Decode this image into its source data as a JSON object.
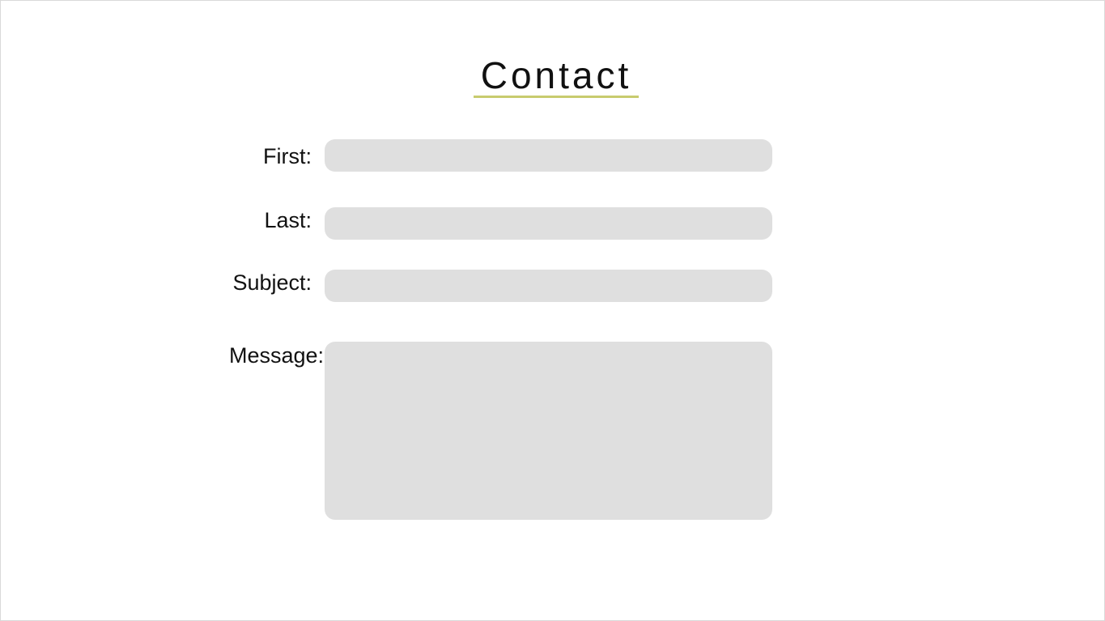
{
  "page": {
    "title": "Contact",
    "accent_color": "#c8cb6e",
    "field_background": "#dfdfdf"
  },
  "form": {
    "first_label": "First:",
    "first_value": "",
    "last_label": "Last:",
    "last_value": "",
    "subject_label": "Subject:",
    "subject_value": "",
    "message_label": "Message:",
    "message_value": ""
  }
}
